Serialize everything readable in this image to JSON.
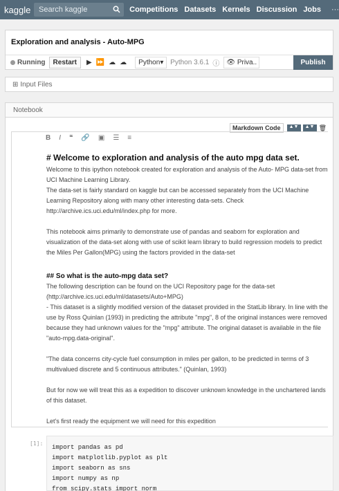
{
  "topbar": {
    "logo": "kaggle",
    "search_placeholder": "Search kaggle",
    "nav": [
      "Competitions",
      "Datasets",
      "Kernels",
      "Discussion",
      "Jobs"
    ],
    "more": "···"
  },
  "editor": {
    "title": "Exploration and analysis - Auto-MPG",
    "status": "Running",
    "restart": "Restart",
    "language": "Python",
    "version": "Python 3.6.1",
    "privacy": "Priva..",
    "publish": "Publish"
  },
  "panels": {
    "input_files": "Input Files",
    "notebook_tab": "Notebook"
  },
  "cell_toolbar": {
    "markdown": "Markdown",
    "code": "Code"
  },
  "markdown_cell": {
    "h1": "# Welcome to exploration and analysis of the auto mpg data set.",
    "p1": "Welcome to this ipython notebook created for exploration and analysis of the Auto- MPG data-set from UCI Machine Learning Library.",
    "p2": "The data-set is fairly standard on kaggle but can be accessed separately from the UCI Machine Learning Repository along with many other interesting data-sets. Check http://archive.ics.uci.edu/ml/index.php for more.",
    "p3": "This notebook aims primarily to demonstrate use of pandas and seaborn for exploration and visualization of the data-set along with use of  scikit learn library to build regression models to predict the Miles Per Gallon(MPG) using the factors provided in the data-set",
    "h2": "## So what is the auto-mpg data set?",
    "p4": " The following description can be found on the UCI Repository page for the data-set (http://archive.ics.uci.edu/ml/datasets/Auto+MPG)",
    "p5": " -  This dataset is a slightly modified version of the dataset provided in the StatLib library. In line with the use by Ross Quinlan (1993) in predicting the attribute \"mpg\", 8 of the original instances were removed because they had unknown values for the \"mpg\" attribute. The original dataset is available in the file \"auto-mpg.data-original\".",
    "p6": "\"The data concerns city-cycle fuel consumption in miles per gallon, to be predicted in terms of 3 multivalued discrete and 5 continuous attributes.\" (Quinlan, 1993)",
    "p7": "But for now we will treat this as a expedition to discover unknown knowledge in the unchartered lands of this dataset.",
    "p8": "Let's first ready the equipment we will need for this expedition"
  },
  "code_cell": {
    "prompt": "[1]:",
    "lines": [
      "import pandas as pd",
      "import matplotlib.pyplot as plt",
      "import seaborn as sns",
      "import numpy as np",
      "from scipy.stats import norm"
    ]
  }
}
